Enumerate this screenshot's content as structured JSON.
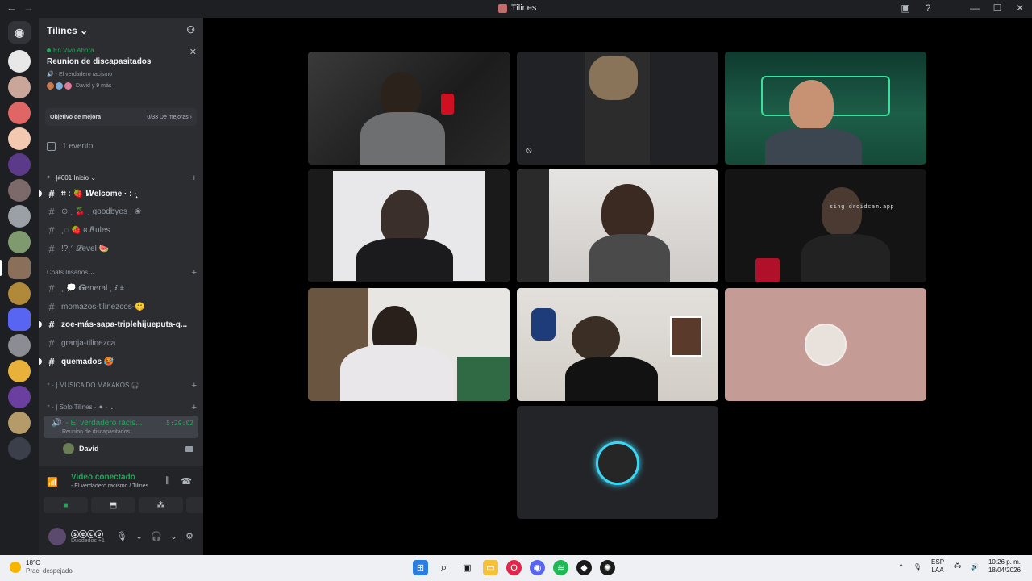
{
  "window": {
    "title": "Tilines",
    "nav_back": "←",
    "nav_forward": "→"
  },
  "server": {
    "name": "Tilines ⌄"
  },
  "live": {
    "tag": "En Vivo Ahora",
    "event_name": "Reunion de discapasitados",
    "channel": "- El verdadero racismo",
    "participants": "David y 9 más"
  },
  "goal": {
    "label": "Objetivo de mejora",
    "progress": "0/33 De mejoras ›"
  },
  "events": {
    "label": "1 evento"
  },
  "categories": {
    "inicio": "⁺ · |#001 Inicio ⌄",
    "chats": "Chats Insanos ⌄",
    "musica": "⁺ · | MUSICA DO MAKAKOS 🎧",
    "solo": "⁺ · | Solo Tilines  · ✦ · ⌄"
  },
  "channels": [
    {
      "name": "⌗ : 🍓 𝙒elcome ·  : ·̩͙",
      "unread": true
    },
    {
      "name": "⊙ ˎ  🍒 ˎ goodbyes ˎ ❀",
      "unread": false
    },
    {
      "name": "ˎ◌ 🍓 ɞ 𝘙ules",
      "unread": false
    },
    {
      "name": "!?ˎᵔ 𝓛evel 🍉",
      "unread": false
    },
    {
      "name": "ˎ 💭 𝙂eneral ˎ ⁝ ⩩",
      "unread": false
    },
    {
      "name": "momazos-tilinezcos-🤫",
      "unread": false
    },
    {
      "name": "zoe-más-sapa-triplehijueputa-q...",
      "unread": true
    },
    {
      "name": "granja-tilinezca",
      "unread": false
    },
    {
      "name": "quemados 🥵",
      "unread": true
    }
  ],
  "voice": {
    "channel": "- El verdadero racis...",
    "timer": "5:29:02",
    "event": "Reunion de discapasitados",
    "user": "David"
  },
  "rtc": {
    "status": "Video conectado",
    "location": "- El verdadero racismo / Tilines"
  },
  "user": {
    "name": "ⓢⓔⓒⓞ",
    "status": "Duodedos +1"
  },
  "stage": {
    "droidcam_text": "sing droidcam.app"
  },
  "taskbar": {
    "temp": "18°C",
    "weather": "Prac. despejado",
    "lang1": "ESP",
    "lang2": "LAA",
    "time": "10:26 p. m.",
    "date": "18/04/2026"
  },
  "colors": {
    "accent": "#23a55a",
    "speaking": "#3fa560",
    "bg": "#2b2d31"
  },
  "icons": [
    "discord-icon",
    "search-icon",
    "mute-icon",
    "camera-icon",
    "hangup-icon",
    "screen-share-icon",
    "activities-icon",
    "soundboard-icon",
    "mic-icon",
    "headphones-icon",
    "gear-icon"
  ]
}
